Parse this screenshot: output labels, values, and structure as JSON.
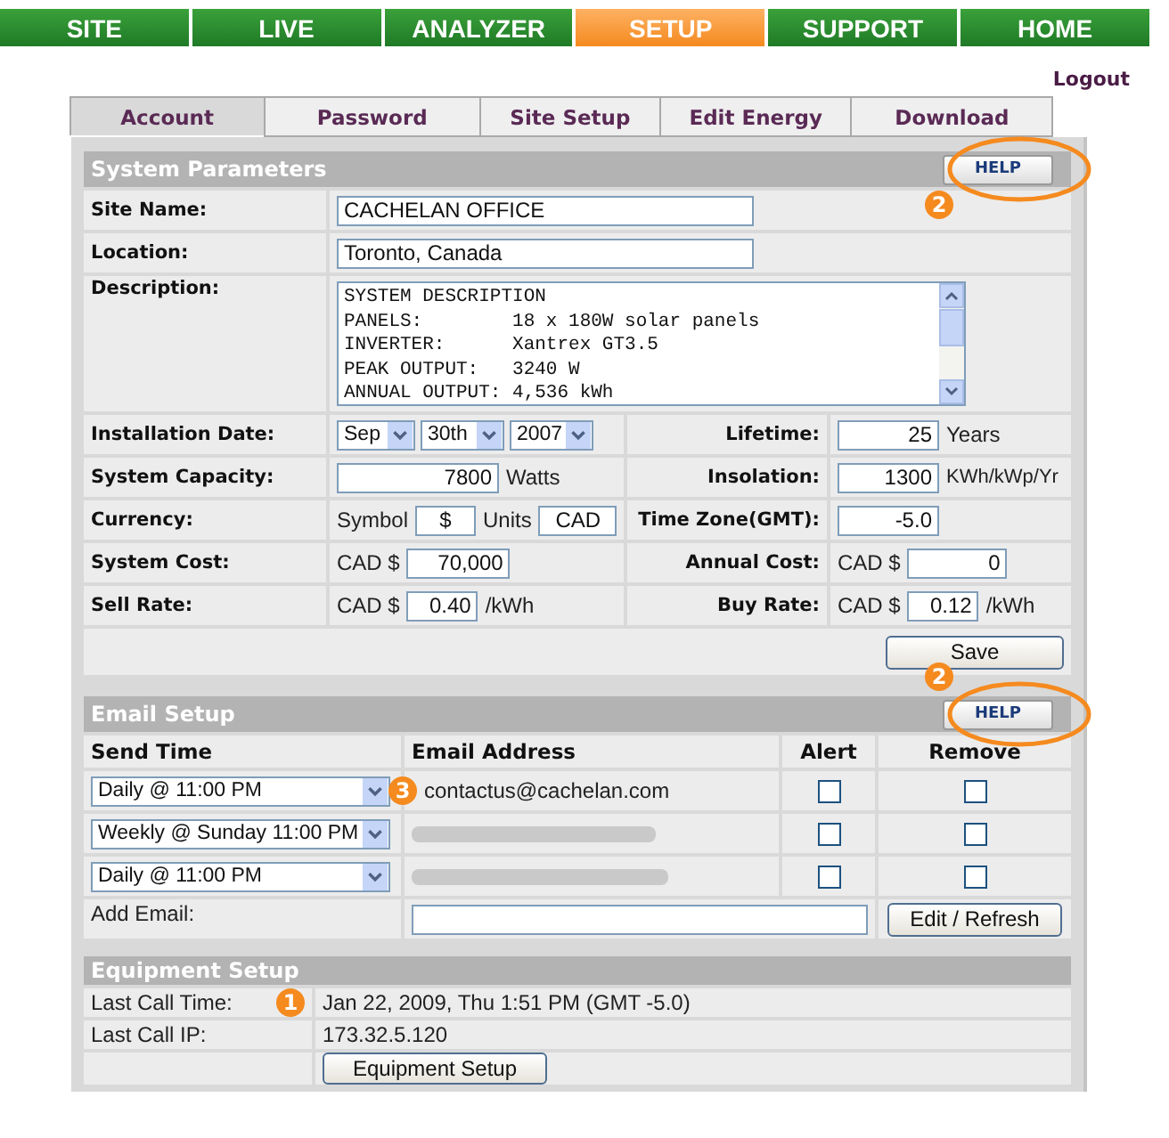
{
  "nav": [
    {
      "label": "SITE",
      "selected": false
    },
    {
      "label": "LIVE",
      "selected": false
    },
    {
      "label": "ANALYZER",
      "selected": false
    },
    {
      "label": "SETUP",
      "selected": true
    },
    {
      "label": "SUPPORT",
      "selected": false
    },
    {
      "label": "HOME",
      "selected": false
    }
  ],
  "logout": "Logout",
  "tabs": [
    {
      "label": "Account",
      "selected": true
    },
    {
      "label": "Password",
      "selected": false
    },
    {
      "label": "Site Setup",
      "selected": false
    },
    {
      "label": "Edit Energy",
      "selected": false
    },
    {
      "label": "Download",
      "selected": false
    }
  ],
  "system_parameters": {
    "title": "System Parameters",
    "help": "HELP",
    "help_highlighted": true,
    "callout": "2",
    "site_name": {
      "label": "Site Name:",
      "value": "CACHELAN OFFICE"
    },
    "location": {
      "label": "Location:",
      "value": "Toronto, Canada"
    },
    "description": {
      "label": "Description:",
      "lines": [
        "SYSTEM DESCRIPTION",
        "PANELS:        18 x 180W solar panels",
        "INVERTER:      Xantrex GT3.5",
        "PEAK OUTPUT:   3240 W",
        "ANNUAL OUTPUT: 4,536 kWh"
      ]
    },
    "installation_date": {
      "label": "Installation Date:",
      "month": "Sep",
      "day": "30th",
      "year": "2007"
    },
    "lifetime": {
      "label": "Lifetime:",
      "value": "25",
      "unit": "Years"
    },
    "system_capacity": {
      "label": "System Capacity:",
      "value": "7800",
      "unit": "Watts"
    },
    "insolation": {
      "label": "Insolation:",
      "value": "1300",
      "unit": "KWh/kWp/Yr"
    },
    "currency": {
      "label": "Currency:",
      "symbol_label": "Symbol",
      "symbol": "$",
      "units_label": "Units",
      "units": "CAD"
    },
    "time_zone": {
      "label": "Time Zone(GMT):",
      "value": "-5.0"
    },
    "system_cost": {
      "label": "System Cost:",
      "prefix": "CAD $",
      "value": "70,000"
    },
    "annual_cost": {
      "label": "Annual Cost:",
      "prefix": "CAD $",
      "value": "0"
    },
    "sell_rate": {
      "label": "Sell Rate:",
      "prefix": "CAD $",
      "value": "0.40",
      "unit": "/kWh"
    },
    "buy_rate": {
      "label": "Buy Rate:",
      "prefix": "CAD $",
      "value": "0.12",
      "unit": "/kWh"
    },
    "save": "Save"
  },
  "email_setup": {
    "title": "Email Setup",
    "help": "HELP",
    "help_highlighted": true,
    "callout": "2",
    "columns": [
      "Send Time",
      "Email Address",
      "Alert",
      "Remove"
    ],
    "rows": [
      {
        "send_time": "Daily @ 11:00 PM",
        "email": "contactus@cachelan.com",
        "redacted": false,
        "callout": "3",
        "alert": false,
        "remove": false
      },
      {
        "send_time": "Weekly @ Sunday 11:00 PM",
        "redacted": true,
        "alert": false,
        "remove": false
      },
      {
        "send_time": "Daily @ 11:00 PM",
        "redacted": true,
        "alert": false,
        "remove": false
      }
    ],
    "add_email_label": "Add Email:",
    "edit_refresh": "Edit / Refresh"
  },
  "equipment_setup": {
    "title": "Equipment Setup",
    "rows": [
      {
        "label": "Last Call Time:",
        "value": "Jan 22, 2009, Thu 1:51 PM (GMT -5.0)",
        "callout": "1"
      },
      {
        "label": "Last Call IP:",
        "value": "173.32.5.120"
      }
    ],
    "button": "Equipment Setup"
  }
}
